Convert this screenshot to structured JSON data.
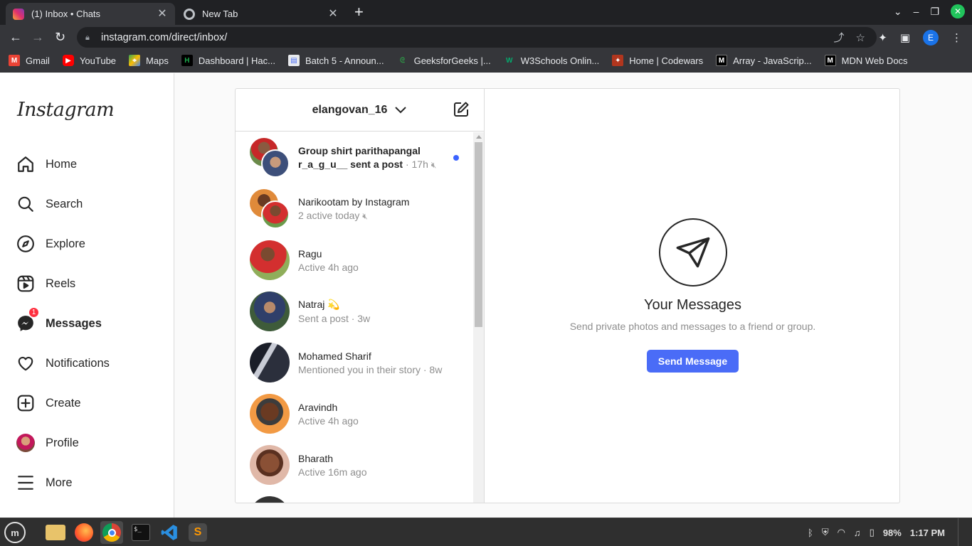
{
  "browser": {
    "tabs": [
      {
        "title": "(1) Inbox • Chats",
        "active": true,
        "icon": "instagram-favicon"
      },
      {
        "title": "New Tab",
        "active": false,
        "icon": "chrome-favicon"
      }
    ],
    "url": "instagram.com/direct/inbox/",
    "profile_initial": "E",
    "bookmarks": [
      {
        "label": "Gmail",
        "icon": "gmail-icon",
        "color": "#ea4335"
      },
      {
        "label": "YouTube",
        "icon": "youtube-icon",
        "color": "#ff0000"
      },
      {
        "label": "Maps",
        "icon": "maps-icon",
        "color": "#34a853"
      },
      {
        "label": "Dashboard | Hac...",
        "icon": "hackerrank-icon",
        "color": "#1ba94c"
      },
      {
        "label": "Batch 5 - Announ...",
        "icon": "announce-icon",
        "color": "#4a6cf7"
      },
      {
        "label": "GeeksforGeeks |...",
        "icon": "gfg-icon",
        "color": "#2f8d46"
      },
      {
        "label": "W3Schools Onlin...",
        "icon": "w3schools-icon",
        "color": "#04aa6d"
      },
      {
        "label": "Home | Codewars",
        "icon": "codewars-icon",
        "color": "#b1361e"
      },
      {
        "label": "Array - JavaScrip...",
        "icon": "mdn-icon",
        "color": "#000000"
      },
      {
        "label": "MDN Web Docs",
        "icon": "mdn-icon",
        "color": "#000000"
      }
    ]
  },
  "instagram": {
    "logo": "Instagram",
    "nav": [
      {
        "label": "Home",
        "icon": "home-icon"
      },
      {
        "label": "Search",
        "icon": "search-icon"
      },
      {
        "label": "Explore",
        "icon": "compass-icon"
      },
      {
        "label": "Reels",
        "icon": "reels-icon"
      },
      {
        "label": "Messages",
        "icon": "messenger-icon",
        "badge": "1",
        "active": true
      },
      {
        "label": "Notifications",
        "icon": "heart-icon"
      },
      {
        "label": "Create",
        "icon": "plus-square-icon"
      },
      {
        "label": "Profile",
        "icon": "profile-avatar"
      },
      {
        "label": "More",
        "icon": "menu-icon"
      }
    ],
    "inbox": {
      "username": "elangovan_16",
      "chats": [
        {
          "name": "Group shirt parithapangal",
          "sub": "r_a_g_u__ sent a post",
          "time": "· 17h",
          "muted": true,
          "unread": true,
          "group": true,
          "c1": "#c44",
          "c2": "#556"
        },
        {
          "name": "Narikootam by Instagram",
          "sub": "2 active today",
          "time": "",
          "muted": true,
          "unread": false,
          "group": true,
          "c1": "#b5652a",
          "c2": "#b33"
        },
        {
          "name": "Ragu",
          "sub": "Active 4h ago",
          "time": "",
          "muted": false,
          "unread": false,
          "group": false,
          "c1": "#5f8a3a"
        },
        {
          "name": "Natraj 💫",
          "sub": "Sent a post",
          "time": "· 3w",
          "muted": false,
          "unread": false,
          "group": false,
          "c1": "#3e5b3a"
        },
        {
          "name": "Mohamed Sharif",
          "sub": "Mentioned you in their story",
          "time": "· 8w",
          "muted": false,
          "unread": false,
          "group": false,
          "c1": "#2b2f3c"
        },
        {
          "name": "Aravindh",
          "sub": "Active 4h ago",
          "time": "",
          "muted": false,
          "unread": false,
          "group": false,
          "c1": "#e8833a"
        },
        {
          "name": "Bharath",
          "sub": "Active 16m ago",
          "time": "",
          "muted": false,
          "unread": false,
          "group": false,
          "c1": "#a0624a"
        }
      ],
      "empty_title": "Your Messages",
      "empty_subtitle": "Send private photos and messages to a friend or group.",
      "send_button": "Send Message"
    }
  },
  "taskbar": {
    "battery": "98%",
    "time": "1:17 PM"
  }
}
